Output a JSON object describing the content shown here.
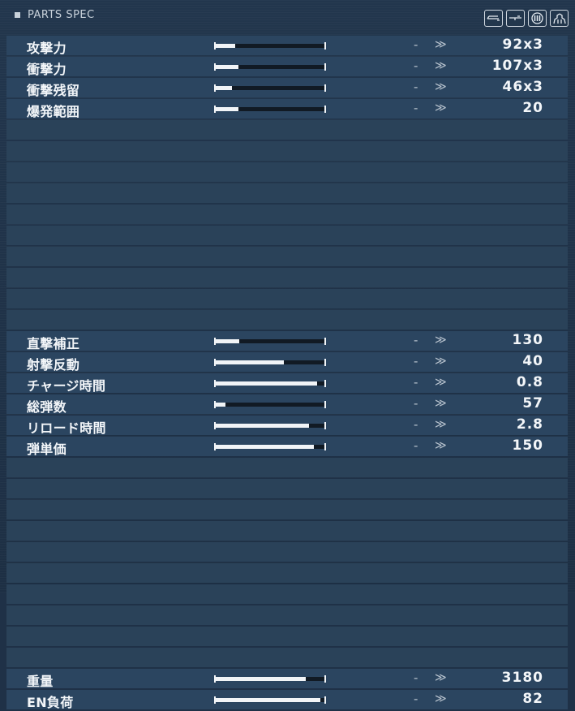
{
  "header": {
    "title": "PARTS SPEC"
  },
  "icons": [
    "weapon-left-icon",
    "weapon-right-icon",
    "ammo-icon",
    "mech-icon"
  ],
  "stats": [
    {
      "label": "攻撃力",
      "fill": 0.18,
      "dash": "-",
      "arrow": "≫",
      "value": "92x3"
    },
    {
      "label": "衝撃力",
      "fill": 0.21,
      "dash": "-",
      "arrow": "≫",
      "value": "107x3"
    },
    {
      "label": "衝撃残留",
      "fill": 0.15,
      "dash": "-",
      "arrow": "≫",
      "value": "46x3"
    },
    {
      "label": "爆発範囲",
      "fill": 0.21,
      "dash": "-",
      "arrow": "≫",
      "value": "20"
    },
    null,
    null,
    null,
    null,
    null,
    null,
    null,
    null,
    null,
    null,
    {
      "label": "直撃補正",
      "fill": 0.22,
      "dash": "-",
      "arrow": "≫",
      "value": "130"
    },
    {
      "label": "射撃反動",
      "fill": 0.63,
      "dash": "-",
      "arrow": "≫",
      "value": "40"
    },
    {
      "label": "チャージ時間",
      "fill": 0.93,
      "dash": "-",
      "arrow": "≫",
      "value": "0.8"
    },
    {
      "label": "総弾数",
      "fill": 0.09,
      "dash": "-",
      "arrow": "≫",
      "value": "57"
    },
    {
      "label": "リロード時間",
      "fill": 0.86,
      "dash": "-",
      "arrow": "≫",
      "value": "2.8"
    },
    {
      "label": "弾単価",
      "fill": 0.9,
      "dash": "-",
      "arrow": "≫",
      "value": "150"
    },
    null,
    null,
    null,
    null,
    null,
    null,
    null,
    null,
    null,
    null,
    {
      "label": "重量",
      "fill": 0.83,
      "dash": "-",
      "arrow": "≫",
      "value": "3180"
    },
    {
      "label": "EN負荷",
      "fill": 0.96,
      "dash": "-",
      "arrow": "≫",
      "value": "82"
    }
  ]
}
